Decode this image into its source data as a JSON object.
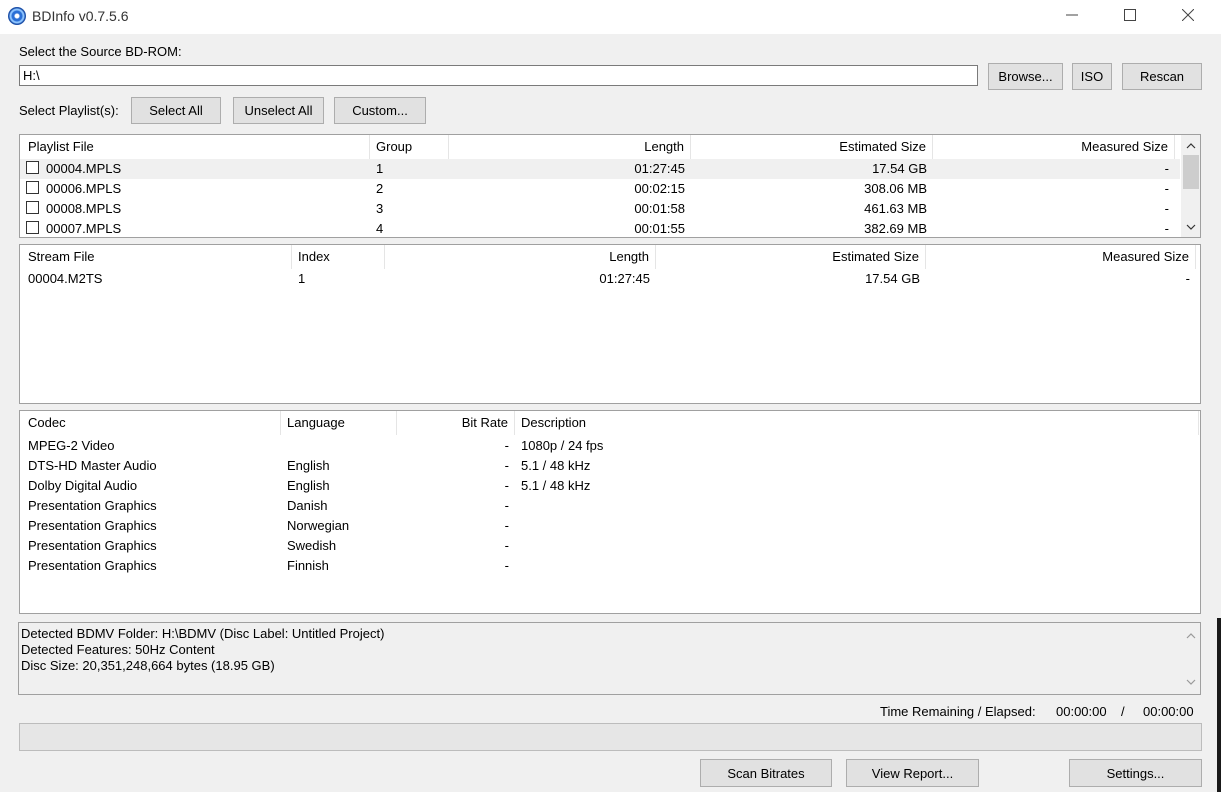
{
  "window": {
    "title": "BDInfo v0.7.5.6"
  },
  "source": {
    "label": "Select the Source BD-ROM:",
    "path": "H:\\",
    "browse": "Browse...",
    "iso": "ISO",
    "rescan": "Rescan"
  },
  "playlist_controls": {
    "label": "Select Playlist(s):",
    "select_all": "Select All",
    "unselect_all": "Unselect All",
    "custom": "Custom..."
  },
  "playlists": {
    "headers": [
      "Playlist File",
      "Group",
      "Length",
      "Estimated Size",
      "Measured Size"
    ],
    "rows": [
      {
        "file": "00004.MPLS",
        "group": "1",
        "length": "01:27:45",
        "est": "17.54 GB",
        "measured": "-",
        "checked": false,
        "selected": true
      },
      {
        "file": "00006.MPLS",
        "group": "2",
        "length": "00:02:15",
        "est": "308.06 MB",
        "measured": "-",
        "checked": false
      },
      {
        "file": "00008.MPLS",
        "group": "3",
        "length": "00:01:58",
        "est": "461.63 MB",
        "measured": "-",
        "checked": false
      },
      {
        "file": "00007.MPLS",
        "group": "4",
        "length": "00:01:55",
        "est": "382.69 MB",
        "measured": "-",
        "checked": false
      }
    ]
  },
  "streams": {
    "headers": [
      "Stream File",
      "Index",
      "Length",
      "Estimated Size",
      "Measured Size"
    ],
    "rows": [
      {
        "file": "00004.M2TS",
        "index": "1",
        "length": "01:27:45",
        "est": "17.54 GB",
        "measured": "-"
      }
    ]
  },
  "codecs": {
    "headers": [
      "Codec",
      "Language",
      "Bit Rate",
      "Description"
    ],
    "rows": [
      {
        "codec": "MPEG-2 Video",
        "language": "",
        "bitrate": "-",
        "desc": "1080p / 24 fps"
      },
      {
        "codec": "DTS-HD Master Audio",
        "language": "English",
        "bitrate": "-",
        "desc": "5.1 / 48 kHz"
      },
      {
        "codec": "Dolby Digital Audio",
        "language": "English",
        "bitrate": "-",
        "desc": "5.1 / 48 kHz"
      },
      {
        "codec": "Presentation Graphics",
        "language": "Danish",
        "bitrate": "-",
        "desc": ""
      },
      {
        "codec": "Presentation Graphics",
        "language": "Norwegian",
        "bitrate": "-",
        "desc": ""
      },
      {
        "codec": "Presentation Graphics",
        "language": "Swedish",
        "bitrate": "-",
        "desc": ""
      },
      {
        "codec": "Presentation Graphics",
        "language": "Finnish",
        "bitrate": "-",
        "desc": ""
      }
    ]
  },
  "log": {
    "lines": [
      "Detected BDMV Folder: H:\\BDMV (Disc Label: Untitled Project)",
      "Detected Features: 50Hz Content",
      "Disc Size: 20,351,248,664 bytes (18.95 GB)"
    ]
  },
  "time": {
    "label": "Time Remaining / Elapsed:",
    "remaining": "00:00:00",
    "separator": "/",
    "elapsed": "00:00:00"
  },
  "progress": {
    "value": 0
  },
  "footer": {
    "scan": "Scan Bitrates",
    "view": "View Report...",
    "settings": "Settings..."
  },
  "colors": {
    "accent": "#0078d7",
    "selected_row": "#f0f0f0",
    "window_bg": "#f0f0f0"
  }
}
